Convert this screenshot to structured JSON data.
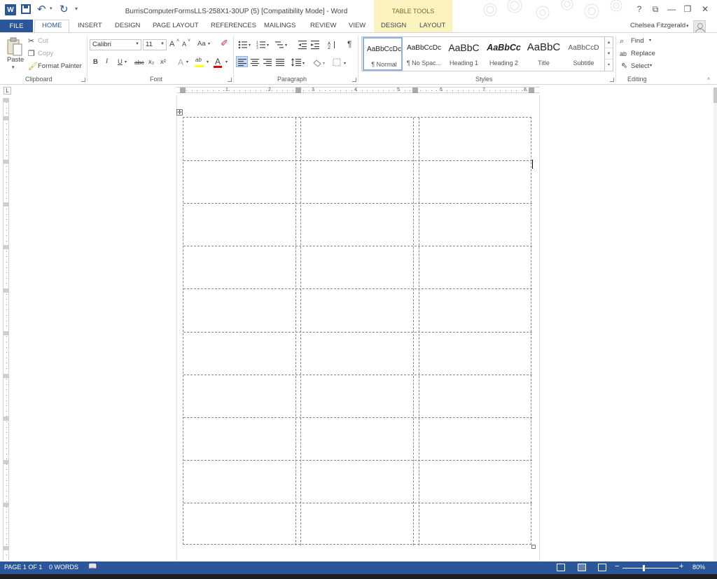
{
  "window": {
    "title": "BurrisComputerFormsLLS-258X1-30UP (5) [Compatibility Mode] - Word",
    "app_icon": "W",
    "contextual_tab_group": "TABLE TOOLS",
    "help": "?",
    "controls": {
      "ribbon_options": "⧉",
      "minimize": "—",
      "restore": "❐",
      "close": "✕"
    }
  },
  "qat": {
    "undo": "↶",
    "undo_more": "▾",
    "redo": "↻",
    "customize": "▾"
  },
  "tabs": [
    {
      "label": "FILE"
    },
    {
      "label": "HOME"
    },
    {
      "label": "INSERT"
    },
    {
      "label": "DESIGN"
    },
    {
      "label": "PAGE LAYOUT"
    },
    {
      "label": "REFERENCES"
    },
    {
      "label": "MAILINGS"
    },
    {
      "label": "REVIEW"
    },
    {
      "label": "VIEW"
    },
    {
      "label": "DESIGN"
    },
    {
      "label": "LAYOUT"
    }
  ],
  "user": {
    "name": "Chelsea Fitzgerald",
    "arrow": "▾"
  },
  "clipboard": {
    "group": "Clipboard",
    "paste": "Paste",
    "paste_arrow": "▾",
    "cut": "Cut",
    "copy": "Copy",
    "format_painter": "Format Painter"
  },
  "font": {
    "group": "Font",
    "family": "Calibri",
    "size": "11",
    "grow": "A",
    "shrink": "A",
    "change_case": "Aa",
    "bold": "B",
    "italic": "I",
    "underline": "U",
    "strikethrough": "abc",
    "subscript": "x₂",
    "superscript": "x²",
    "text_effects": "A",
    "highlight": "ab",
    "font_color": "A"
  },
  "paragraph": {
    "group": "Paragraph",
    "show_marks": "¶"
  },
  "styles": {
    "group": "Styles",
    "items": [
      {
        "preview": "AaBbCcDc",
        "name": "¶ Normal"
      },
      {
        "preview": "AaBbCcDc",
        "name": "¶ No Spac..."
      },
      {
        "preview": "AaBbC",
        "name": "Heading 1"
      },
      {
        "preview": "AaBbCc",
        "name": "Heading 2"
      },
      {
        "preview": "AaBbC",
        "name": "Title"
      },
      {
        "preview": "AaBbCcD",
        "name": "Subtitle"
      }
    ]
  },
  "editing": {
    "group": "Editing",
    "find": "Find",
    "find_arrow": "▾",
    "replace": "Replace",
    "select": "Select",
    "select_arrow": "▾"
  },
  "ruler": {
    "corner": "L",
    "numbers": [
      "1",
      "2",
      "3",
      "4",
      "5",
      "6",
      "7",
      "8"
    ]
  },
  "table": {
    "rows": 10,
    "columns": 3
  },
  "status": {
    "page": "PAGE 1 OF 1",
    "words": "0 WORDS",
    "zoom_out": "−",
    "zoom_in": "+",
    "zoom": "80%"
  },
  "colors": {
    "accent": "#2b579a",
    "contextual": "#fdf3c0",
    "font_color_bar": "#e00000",
    "highlight_bar": "#ffff00"
  }
}
